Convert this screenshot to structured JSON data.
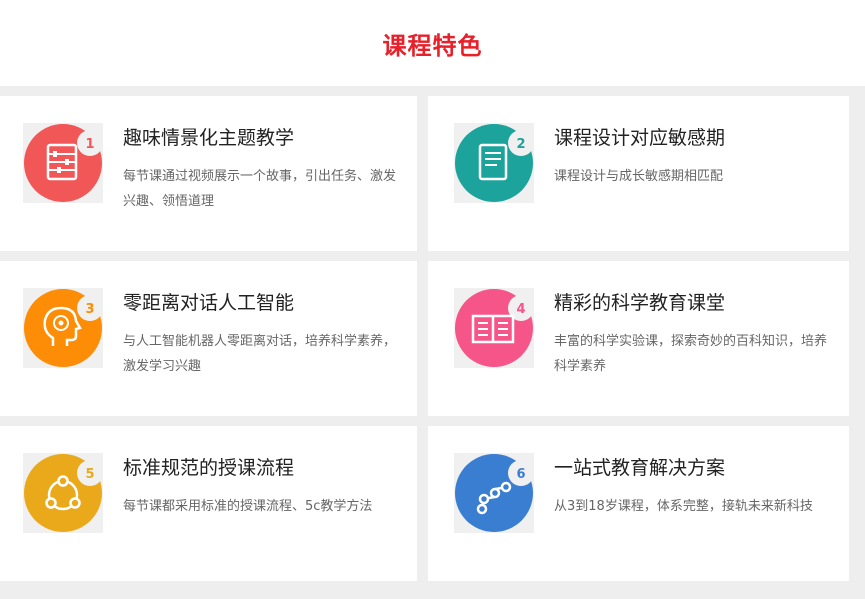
{
  "section": {
    "title": "课程特色"
  },
  "cards": [
    {
      "number": "1",
      "title": "趣味情景化主题教学",
      "desc": "每节课通过视频展示一个故事，引出任务、激发兴趣、领悟道理",
      "color": "#f25757",
      "icon": "abacus-icon"
    },
    {
      "number": "2",
      "title": "课程设计对应敏感期",
      "desc": "课程设计与成长敏感期相匹配",
      "color": "#1ba39c",
      "icon": "book-icon"
    },
    {
      "number": "3",
      "title": "零距离对话人工智能",
      "desc": "与人工智能机器人零距离对话，培养科学素养，激发学习兴趣",
      "color": "#fd8c06",
      "icon": "head-brain-icon"
    },
    {
      "number": "4",
      "title": "精彩的科学教育课堂",
      "desc": "丰富的科学实验课，探索奇妙的百科知识，培养科学素养",
      "color": "#f55589",
      "icon": "open-book-icon"
    },
    {
      "number": "5",
      "title": "标准规范的授课流程",
      "desc": "每节课都采用标准的授课流程、5c教学方法",
      "color": "#eaa91b",
      "icon": "cycle-icon"
    },
    {
      "number": "6",
      "title": "一站式教育解决方案",
      "desc": "从3到18岁课程，体系完整，接轨未来新科技",
      "color": "#3a7ed1",
      "icon": "path-nodes-icon"
    }
  ]
}
